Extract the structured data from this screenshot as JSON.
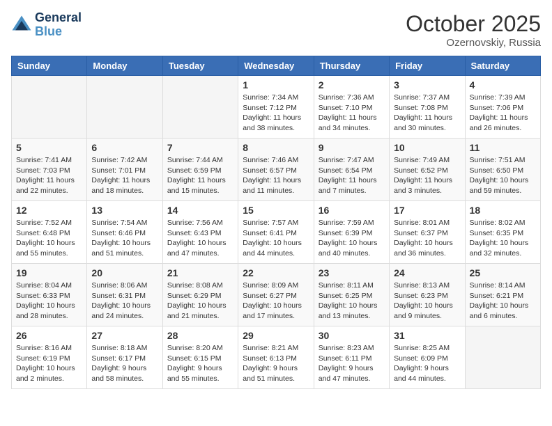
{
  "header": {
    "logo_line1": "General",
    "logo_line2": "Blue",
    "month_title": "October 2025",
    "location": "Ozernovskiy, Russia"
  },
  "weekdays": [
    "Sunday",
    "Monday",
    "Tuesday",
    "Wednesday",
    "Thursday",
    "Friday",
    "Saturday"
  ],
  "weeks": [
    [
      {
        "day": "",
        "info": ""
      },
      {
        "day": "",
        "info": ""
      },
      {
        "day": "",
        "info": ""
      },
      {
        "day": "1",
        "info": "Sunrise: 7:34 AM\nSunset: 7:12 PM\nDaylight: 11 hours\nand 38 minutes."
      },
      {
        "day": "2",
        "info": "Sunrise: 7:36 AM\nSunset: 7:10 PM\nDaylight: 11 hours\nand 34 minutes."
      },
      {
        "day": "3",
        "info": "Sunrise: 7:37 AM\nSunset: 7:08 PM\nDaylight: 11 hours\nand 30 minutes."
      },
      {
        "day": "4",
        "info": "Sunrise: 7:39 AM\nSunset: 7:06 PM\nDaylight: 11 hours\nand 26 minutes."
      }
    ],
    [
      {
        "day": "5",
        "info": "Sunrise: 7:41 AM\nSunset: 7:03 PM\nDaylight: 11 hours\nand 22 minutes."
      },
      {
        "day": "6",
        "info": "Sunrise: 7:42 AM\nSunset: 7:01 PM\nDaylight: 11 hours\nand 18 minutes."
      },
      {
        "day": "7",
        "info": "Sunrise: 7:44 AM\nSunset: 6:59 PM\nDaylight: 11 hours\nand 15 minutes."
      },
      {
        "day": "8",
        "info": "Sunrise: 7:46 AM\nSunset: 6:57 PM\nDaylight: 11 hours\nand 11 minutes."
      },
      {
        "day": "9",
        "info": "Sunrise: 7:47 AM\nSunset: 6:54 PM\nDaylight: 11 hours\nand 7 minutes."
      },
      {
        "day": "10",
        "info": "Sunrise: 7:49 AM\nSunset: 6:52 PM\nDaylight: 11 hours\nand 3 minutes."
      },
      {
        "day": "11",
        "info": "Sunrise: 7:51 AM\nSunset: 6:50 PM\nDaylight: 10 hours\nand 59 minutes."
      }
    ],
    [
      {
        "day": "12",
        "info": "Sunrise: 7:52 AM\nSunset: 6:48 PM\nDaylight: 10 hours\nand 55 minutes."
      },
      {
        "day": "13",
        "info": "Sunrise: 7:54 AM\nSunset: 6:46 PM\nDaylight: 10 hours\nand 51 minutes."
      },
      {
        "day": "14",
        "info": "Sunrise: 7:56 AM\nSunset: 6:43 PM\nDaylight: 10 hours\nand 47 minutes."
      },
      {
        "day": "15",
        "info": "Sunrise: 7:57 AM\nSunset: 6:41 PM\nDaylight: 10 hours\nand 44 minutes."
      },
      {
        "day": "16",
        "info": "Sunrise: 7:59 AM\nSunset: 6:39 PM\nDaylight: 10 hours\nand 40 minutes."
      },
      {
        "day": "17",
        "info": "Sunrise: 8:01 AM\nSunset: 6:37 PM\nDaylight: 10 hours\nand 36 minutes."
      },
      {
        "day": "18",
        "info": "Sunrise: 8:02 AM\nSunset: 6:35 PM\nDaylight: 10 hours\nand 32 minutes."
      }
    ],
    [
      {
        "day": "19",
        "info": "Sunrise: 8:04 AM\nSunset: 6:33 PM\nDaylight: 10 hours\nand 28 minutes."
      },
      {
        "day": "20",
        "info": "Sunrise: 8:06 AM\nSunset: 6:31 PM\nDaylight: 10 hours\nand 24 minutes."
      },
      {
        "day": "21",
        "info": "Sunrise: 8:08 AM\nSunset: 6:29 PM\nDaylight: 10 hours\nand 21 minutes."
      },
      {
        "day": "22",
        "info": "Sunrise: 8:09 AM\nSunset: 6:27 PM\nDaylight: 10 hours\nand 17 minutes."
      },
      {
        "day": "23",
        "info": "Sunrise: 8:11 AM\nSunset: 6:25 PM\nDaylight: 10 hours\nand 13 minutes."
      },
      {
        "day": "24",
        "info": "Sunrise: 8:13 AM\nSunset: 6:23 PM\nDaylight: 10 hours\nand 9 minutes."
      },
      {
        "day": "25",
        "info": "Sunrise: 8:14 AM\nSunset: 6:21 PM\nDaylight: 10 hours\nand 6 minutes."
      }
    ],
    [
      {
        "day": "26",
        "info": "Sunrise: 8:16 AM\nSunset: 6:19 PM\nDaylight: 10 hours\nand 2 minutes."
      },
      {
        "day": "27",
        "info": "Sunrise: 8:18 AM\nSunset: 6:17 PM\nDaylight: 9 hours\nand 58 minutes."
      },
      {
        "day": "28",
        "info": "Sunrise: 8:20 AM\nSunset: 6:15 PM\nDaylight: 9 hours\nand 55 minutes."
      },
      {
        "day": "29",
        "info": "Sunrise: 8:21 AM\nSunset: 6:13 PM\nDaylight: 9 hours\nand 51 minutes."
      },
      {
        "day": "30",
        "info": "Sunrise: 8:23 AM\nSunset: 6:11 PM\nDaylight: 9 hours\nand 47 minutes."
      },
      {
        "day": "31",
        "info": "Sunrise: 8:25 AM\nSunset: 6:09 PM\nDaylight: 9 hours\nand 44 minutes."
      },
      {
        "day": "",
        "info": ""
      }
    ]
  ]
}
